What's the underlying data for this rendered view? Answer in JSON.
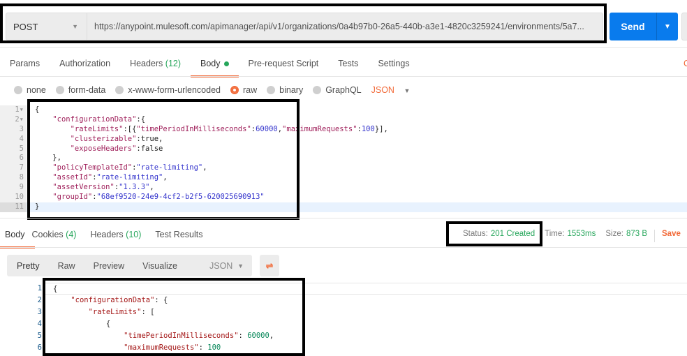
{
  "request": {
    "method": "POST",
    "url": "https://anypoint.mulesoft.com/apimanager/api/v1/organizations/0a4b97b0-26a5-440b-a3e1-4820c3259241/environments/5a7...",
    "send_label": "Send"
  },
  "req_tabs": [
    {
      "label": "Params"
    },
    {
      "label": "Authorization"
    },
    {
      "label": "Headers",
      "count": "(12)"
    },
    {
      "label": "Body"
    },
    {
      "label": "Pre-request Script"
    },
    {
      "label": "Tests"
    },
    {
      "label": "Settings"
    }
  ],
  "cookies_cut": "C",
  "body_types": [
    "none",
    "form-data",
    "x-www-form-urlencoded",
    "raw",
    "binary",
    "GraphQL"
  ],
  "body_selected": "raw",
  "body_format": "JSON",
  "request_body": [
    [
      [
        "p",
        "{"
      ]
    ],
    [
      [
        "p",
        "    "
      ],
      [
        "k",
        "\"configurationData\""
      ],
      [
        "p",
        ":{"
      ]
    ],
    [
      [
        "p",
        "        "
      ],
      [
        "k",
        "\"rateLimits\""
      ],
      [
        "p",
        ":[{"
      ],
      [
        "k",
        "\"timePeriodInMilliseconds\""
      ],
      [
        "p",
        ":"
      ],
      [
        "num",
        "60000"
      ],
      [
        "p",
        ","
      ],
      [
        "k",
        "\"maximumRequests\""
      ],
      [
        "p",
        ":"
      ],
      [
        "num",
        "100"
      ],
      [
        "p",
        "}],"
      ]
    ],
    [
      [
        "p",
        "        "
      ],
      [
        "k",
        "\"clusterizable\""
      ],
      [
        "p",
        ":true,"
      ]
    ],
    [
      [
        "p",
        "        "
      ],
      [
        "k",
        "\"exposeHeaders\""
      ],
      [
        "p",
        ":false"
      ]
    ],
    [
      [
        "p",
        "    },"
      ]
    ],
    [
      [
        "p",
        "    "
      ],
      [
        "k",
        "\"policyTemplateId\""
      ],
      [
        "p",
        ":"
      ],
      [
        "s",
        "\"rate-limiting\""
      ],
      [
        "p",
        ","
      ]
    ],
    [
      [
        "p",
        "    "
      ],
      [
        "k",
        "\"assetId\""
      ],
      [
        "p",
        ":"
      ],
      [
        "s",
        "\"rate-limiting\""
      ],
      [
        "p",
        ","
      ]
    ],
    [
      [
        "p",
        "    "
      ],
      [
        "k",
        "\"assetVersion\""
      ],
      [
        "p",
        ":"
      ],
      [
        "s",
        "\"1.3.3\""
      ],
      [
        "p",
        ","
      ]
    ],
    [
      [
        "p",
        "    "
      ],
      [
        "k",
        "\"groupId\""
      ],
      [
        "p",
        ":"
      ],
      [
        "s",
        "\"68ef9520-24e9-4cf2-b2f5-620025690913\""
      ]
    ],
    [
      [
        "p",
        "}"
      ]
    ]
  ],
  "resp_tabs": [
    {
      "label": "Body"
    },
    {
      "label": "Cookies",
      "count": "(4)"
    },
    {
      "label": "Headers",
      "count": "(10)"
    },
    {
      "label": "Test Results"
    }
  ],
  "status": {
    "status_label": "Status:",
    "status": "201 Created",
    "time_label": "Time:",
    "time": "1553ms",
    "size_label": "Size:",
    "size": "873 B",
    "save": "Save"
  },
  "view_modes": [
    "Pretty",
    "Raw",
    "Preview",
    "Visualize"
  ],
  "resp_format": "JSON",
  "response_body": [
    [
      [
        "p",
        "{"
      ]
    ],
    [
      [
        "p",
        "    "
      ],
      [
        "rk",
        "\"configurationData\""
      ],
      [
        "p",
        ": {"
      ]
    ],
    [
      [
        "p",
        "        "
      ],
      [
        "rk",
        "\"rateLimits\""
      ],
      [
        "p",
        ": ["
      ]
    ],
    [
      [
        "p",
        "            {"
      ]
    ],
    [
      [
        "p",
        "                "
      ],
      [
        "rk",
        "\"timePeriodInMilliseconds\""
      ],
      [
        "p",
        ": "
      ],
      [
        "rn",
        "60000"
      ],
      [
        "p",
        ","
      ]
    ],
    [
      [
        "p",
        "                "
      ],
      [
        "rk",
        "\"maximumRequests\""
      ],
      [
        "p",
        ": "
      ],
      [
        "rn",
        "100"
      ]
    ]
  ]
}
